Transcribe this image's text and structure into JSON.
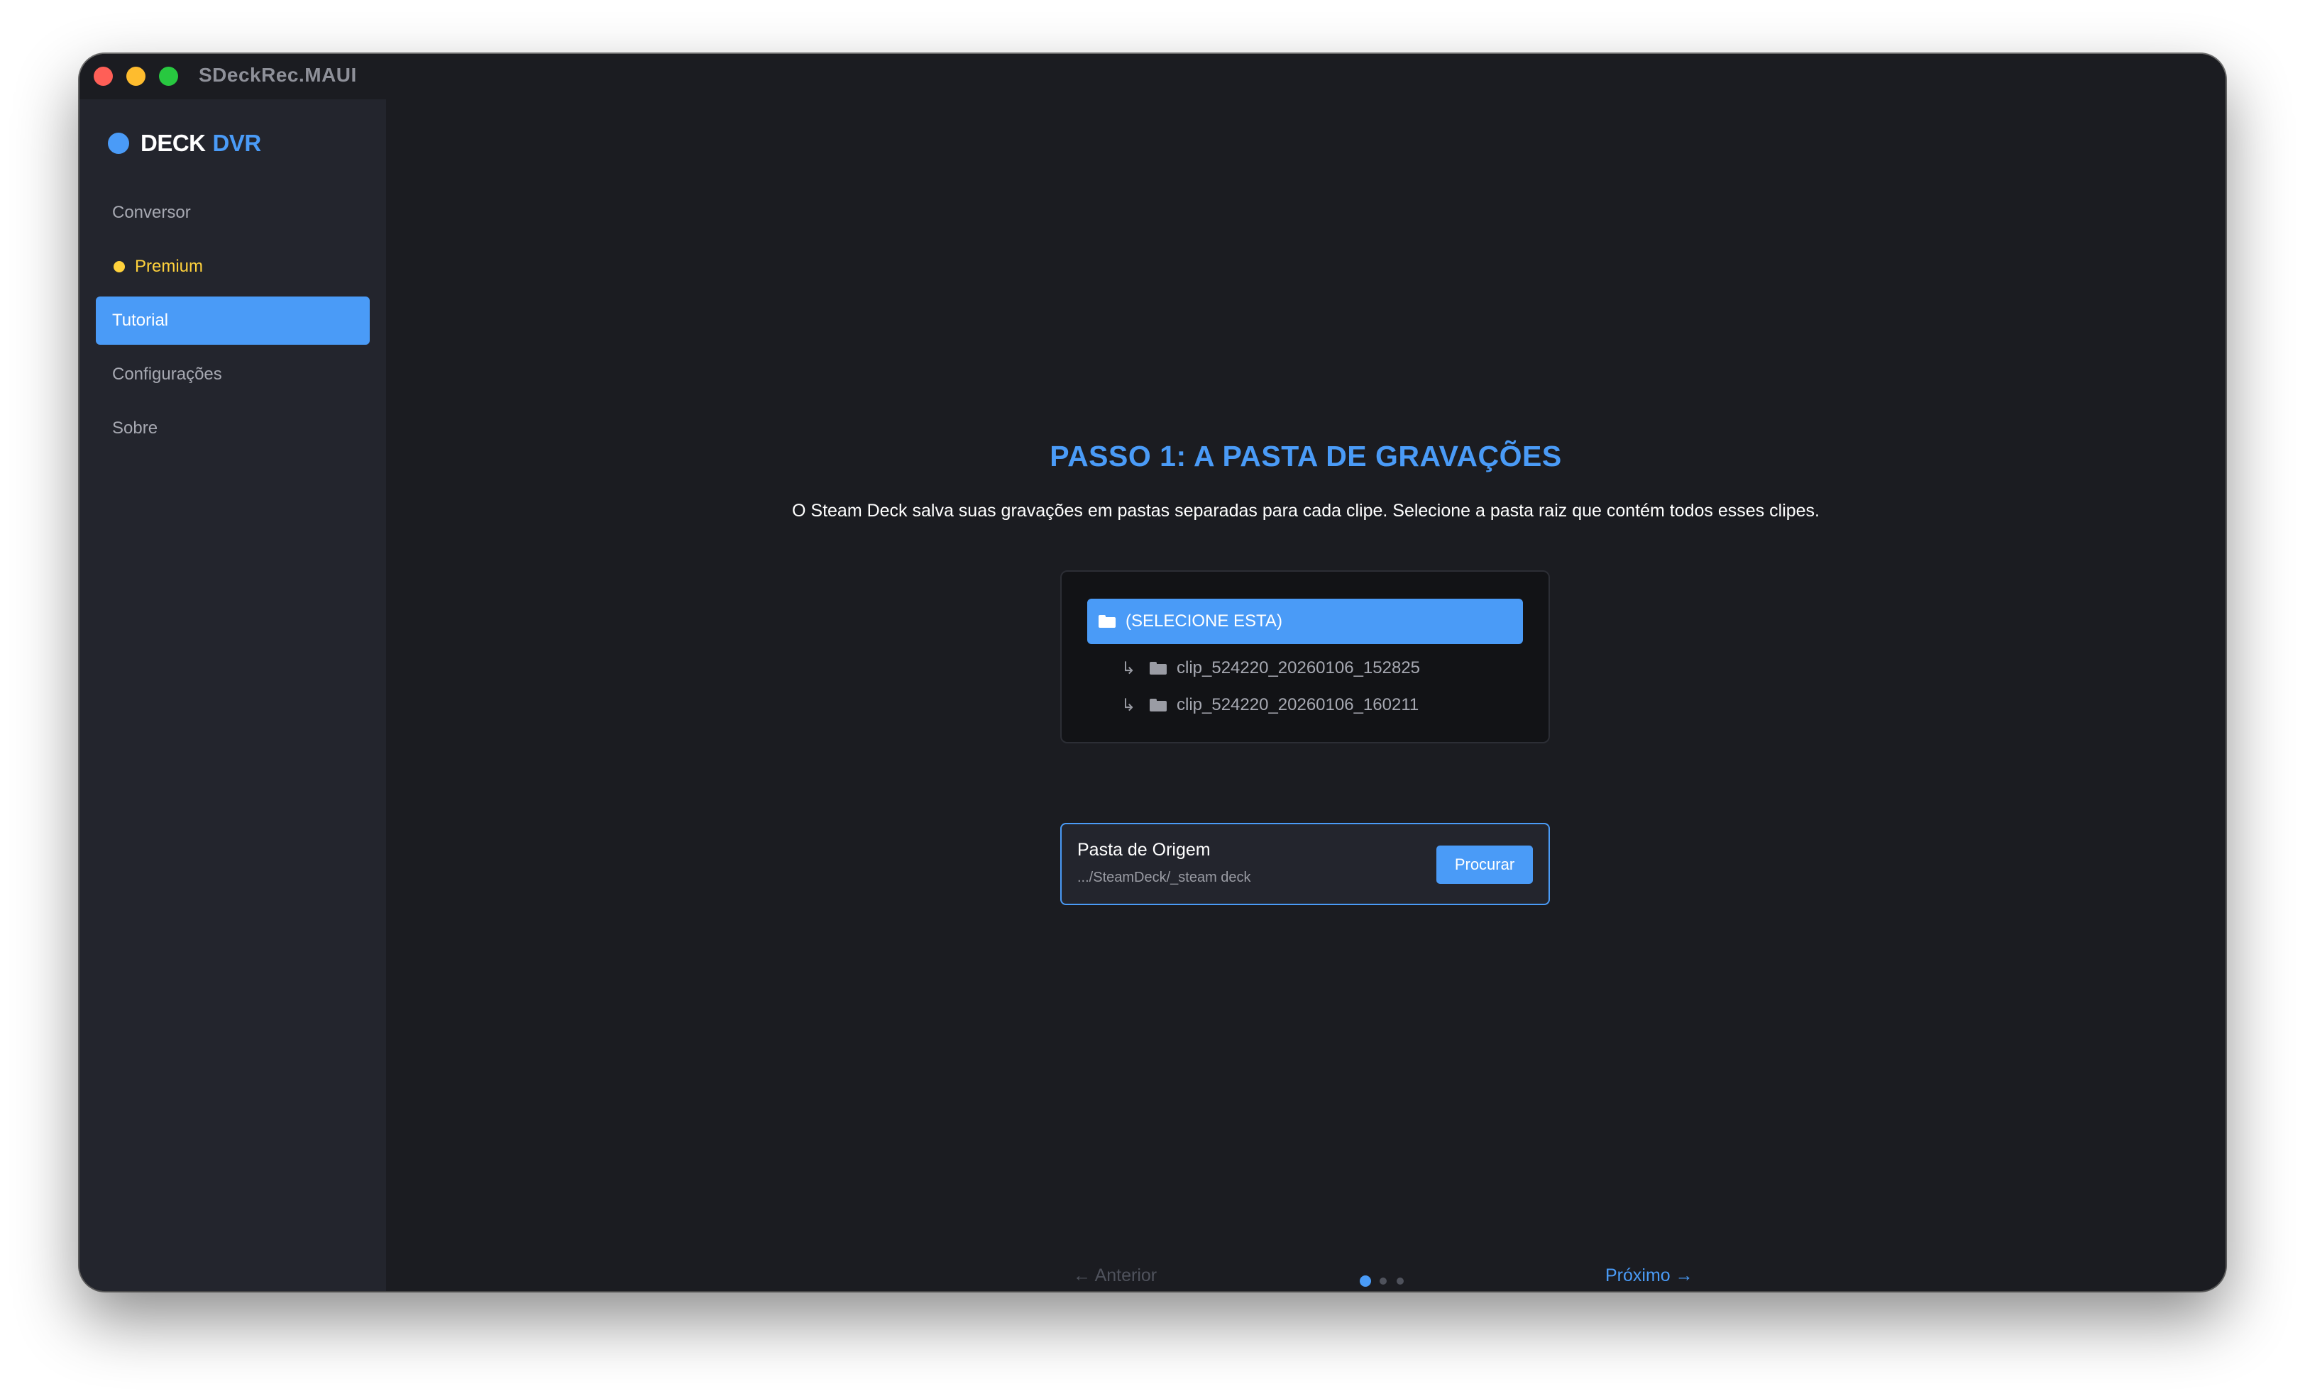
{
  "window": {
    "title": "SDeckRec.MAUI"
  },
  "sidebar": {
    "brand_primary": "DECK",
    "brand_accent": "DVR",
    "items": [
      {
        "label": "Conversor"
      },
      {
        "label": "Premium"
      },
      {
        "label": "Tutorial",
        "active": true
      },
      {
        "label": "Configurações"
      },
      {
        "label": "Sobre"
      }
    ]
  },
  "main": {
    "step_title": "PASSO 1: A PASTA DE GRAVAÇÕES",
    "step_description": "O Steam Deck salva suas gravações em pastas separadas para cada clipe. Selecione a pasta raiz que contém todos esses clipes.",
    "folder_tree": {
      "root_label": "(SELECIONE ESTA)",
      "branch_symbol": "↳",
      "children": [
        "clip_524220_20260106_152825",
        "clip_524220_20260106_160211"
      ]
    },
    "source": {
      "label": "Pasta de Origem",
      "path": ".../SteamDeck/_steam deck",
      "browse_label": "Procurar"
    },
    "navigation": {
      "prev_label": "← Anterior",
      "next_label": "Próximo →",
      "total_steps": 3,
      "current_step": 1
    }
  },
  "colors": {
    "accent": "#4a9bf7",
    "premium": "#ffd23c",
    "background": "#1b1c21",
    "sidebar": "#23252d"
  }
}
